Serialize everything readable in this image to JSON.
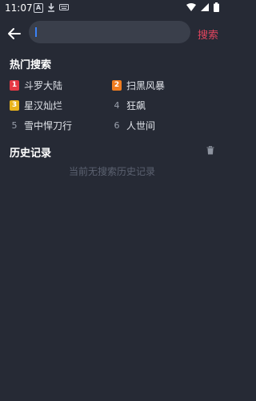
{
  "status_bar": {
    "time": "11:07",
    "a_badge": "A"
  },
  "search": {
    "value": "",
    "button_label": "搜索"
  },
  "hot_search": {
    "title": "热门搜索",
    "items": [
      {
        "rank": "1",
        "label": "斗罗大陆",
        "rank_color": "#e53945"
      },
      {
        "rank": "2",
        "label": "扫黑风暴",
        "rank_color": "#f07c1f"
      },
      {
        "rank": "3",
        "label": "星汉灿烂",
        "rank_color": "#e8b31a"
      },
      {
        "rank": "4",
        "label": "狂飙",
        "rank_color": ""
      },
      {
        "rank": "5",
        "label": "雪中悍刀行",
        "rank_color": ""
      },
      {
        "rank": "6",
        "label": "人世间",
        "rank_color": ""
      }
    ]
  },
  "history": {
    "title": "历史记录",
    "empty_text": "当前无搜索历史记录"
  },
  "colors": {
    "background": "#262a35",
    "accent": "#e2455e",
    "search_box": "#3a3f4b"
  }
}
